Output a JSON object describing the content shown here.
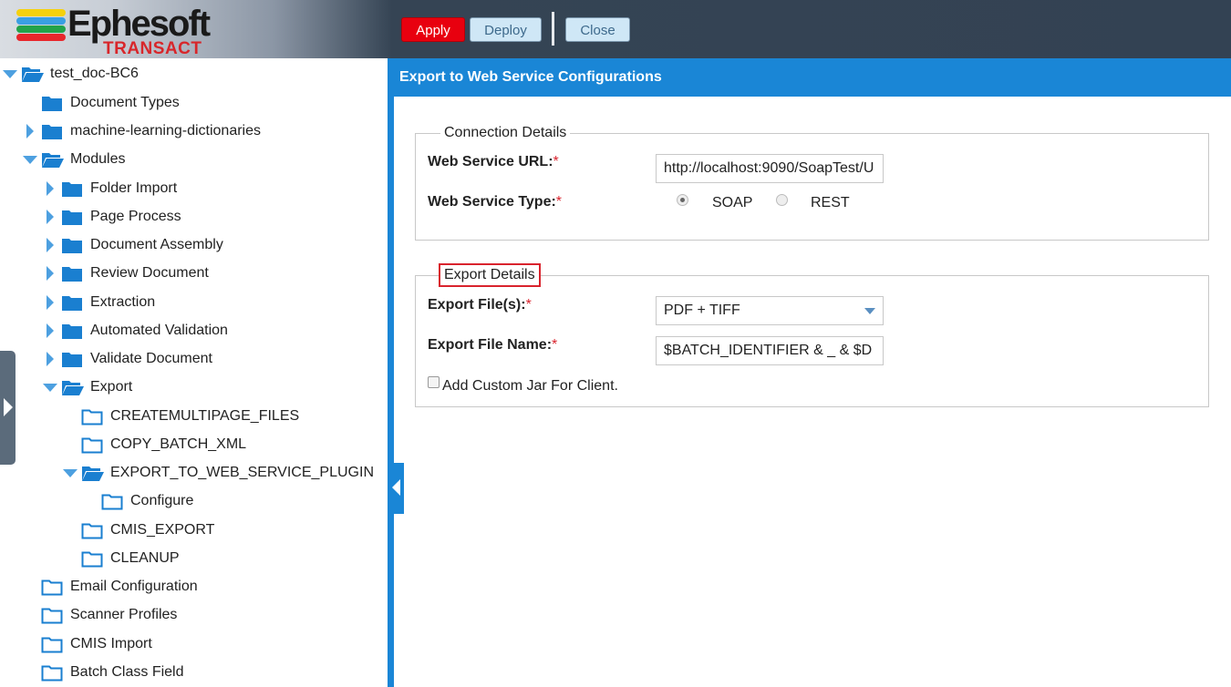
{
  "header": {
    "logo_text": "Ephesoft",
    "logo_sub": "TRANSACT",
    "apply_label": "Apply",
    "deploy_label": "Deploy",
    "close_label": "Close"
  },
  "tree": {
    "nodes": [
      {
        "label": "test_doc-BC6",
        "toggle": "down",
        "folder": "open-solid"
      },
      {
        "label": "Document Types",
        "toggle": "none",
        "folder": "solid"
      },
      {
        "label": "machine-learning-dictionaries",
        "toggle": "right",
        "folder": "solid"
      },
      {
        "label": "Modules",
        "toggle": "down",
        "folder": "open-solid"
      },
      {
        "label": "Folder Import",
        "toggle": "right",
        "folder": "solid"
      },
      {
        "label": "Page Process",
        "toggle": "right",
        "folder": "solid"
      },
      {
        "label": "Document Assembly",
        "toggle": "right",
        "folder": "solid"
      },
      {
        "label": "Review Document",
        "toggle": "right",
        "folder": "solid"
      },
      {
        "label": "Extraction",
        "toggle": "right",
        "folder": "solid"
      },
      {
        "label": "Automated Validation",
        "toggle": "right",
        "folder": "solid"
      },
      {
        "label": "Validate Document",
        "toggle": "right",
        "folder": "solid"
      },
      {
        "label": "Export",
        "toggle": "down",
        "folder": "open-solid"
      },
      {
        "label": "CREATEMULTIPAGE_FILES",
        "toggle": "none",
        "folder": "outline"
      },
      {
        "label": "COPY_BATCH_XML",
        "toggle": "none",
        "folder": "outline"
      },
      {
        "label": "EXPORT_TO_WEB_SERVICE_PLUGIN",
        "toggle": "down",
        "folder": "open-solid"
      },
      {
        "label": "Configure",
        "toggle": "none",
        "folder": "outline"
      },
      {
        "label": "CMIS_EXPORT",
        "toggle": "none",
        "folder": "outline"
      },
      {
        "label": "CLEANUP",
        "toggle": "none",
        "folder": "outline"
      },
      {
        "label": "Email Configuration",
        "toggle": "none",
        "folder": "outline"
      },
      {
        "label": "Scanner Profiles",
        "toggle": "none",
        "folder": "outline"
      },
      {
        "label": "CMIS Import",
        "toggle": "none",
        "folder": "outline"
      },
      {
        "label": "Batch Class Field",
        "toggle": "none",
        "folder": "outline"
      }
    ]
  },
  "panel": {
    "title": "Export to Web Service Configurations",
    "connection": {
      "legend": "Connection Details",
      "url_label": "Web Service URL:",
      "url_value": "http://localhost:9090/SoapTest/U",
      "type_label": "Web Service Type:",
      "type_options": [
        "SOAP",
        "REST"
      ],
      "type_selected": "SOAP"
    },
    "export": {
      "legend": "Export Details",
      "files_label": "Export File(s):",
      "files_value": "PDF + TIFF",
      "name_label": "Export File Name:",
      "name_value": "$BATCH_IDENTIFIER & _ & $D",
      "custom_jar_label": "Add Custom Jar For Client.",
      "custom_jar_checked": false
    },
    "required_mark": "*"
  },
  "colors": {
    "accent": "#1a86d6",
    "apply": "#e8000f",
    "required": "#d9232d",
    "folder": "#1a7fd0"
  }
}
